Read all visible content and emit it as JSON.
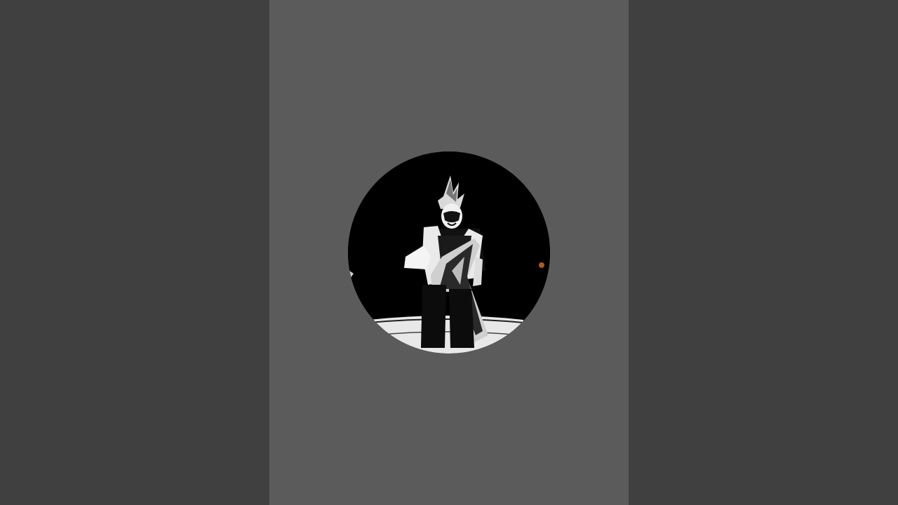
{
  "video": {
    "layout": "vertical-short-pillarboxed",
    "colors": {
      "pillarbox": "#404040",
      "panel": "#5b5b5b",
      "avatar_background": "#000000"
    },
    "avatar": {
      "icon": "channel-avatar-image"
    }
  }
}
